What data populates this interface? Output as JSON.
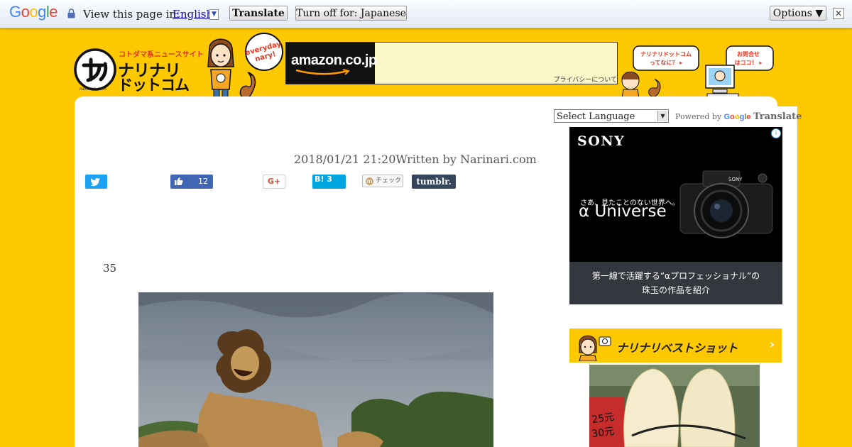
{
  "translate_bar": {
    "google_logo": "Google",
    "view_label": "View this page in:",
    "language": "English",
    "translate_button": "Translate",
    "turn_off_button": "Turn off for: Japanese",
    "options_button": "Options ▼",
    "close_icon": "✕"
  },
  "header": {
    "logo_tagline": "コトダマ系ニュースサイト",
    "logo_line1": "ナリナリ",
    "logo_line2": "ドットコム",
    "logo_sub": "narinari.com",
    "mascot_bubble": "everyday nary!",
    "ad": {
      "amazon": "amazon.co.jp",
      "privacy": "プライバシーについて"
    },
    "nav_about": "ナリナリドットコムってなに？",
    "nav_contact": "お問合せはココ！"
  },
  "sidebar": {
    "language_select": "Select Language",
    "powered_by": "Powered by",
    "powered_google": "Google",
    "powered_translate": "Translate",
    "sony_ad": {
      "logo": "SONY",
      "tagline": "さあ、見たことのない世界へ。",
      "product": "α Universe",
      "line1": "第一線で活躍する“αプロフェッショナル”の",
      "line2": "珠玉の作品を紹介",
      "adchoice": "i"
    },
    "best_shot": "ナリナリベストショット",
    "best_arrow": "›"
  },
  "article": {
    "meta": "2018/01/21 21:20Written by Narinari.com",
    "number": "35"
  },
  "share": {
    "facebook_count": "12",
    "gplus": "G+",
    "hatena": "B! 3",
    "mixi": "チェック",
    "tumblr": "tumblr."
  },
  "colors": {
    "site_yellow": "#fec900",
    "twitter": "#1da1f2",
    "facebook": "#4267b2",
    "hatena": "#00a4de",
    "tumblr": "#35465c"
  }
}
